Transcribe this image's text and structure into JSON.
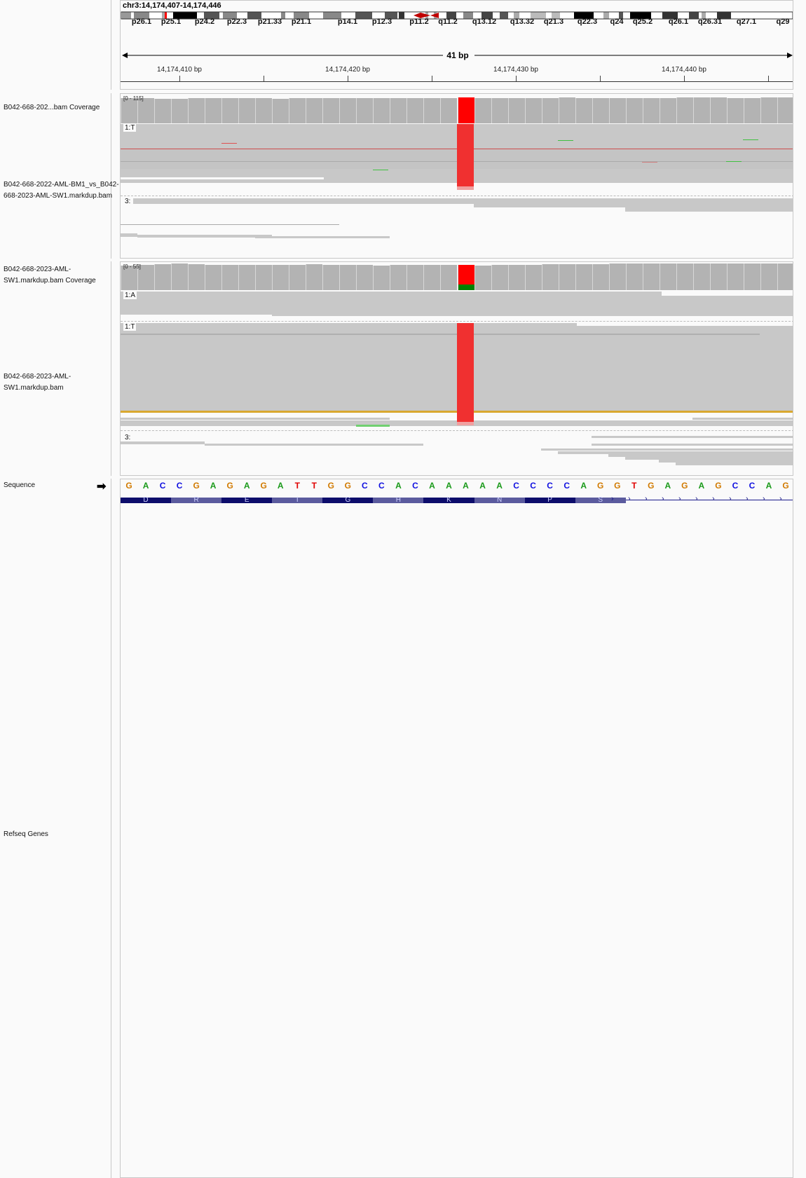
{
  "header": {
    "locus": "chr3:14,174,407-14,174,446",
    "bands": [
      "p26.1",
      "p25.1",
      "p24.2",
      "p22.3",
      "p21.33",
      "p21.1",
      "p14.1",
      "p12.3",
      "p11.2",
      "q11.2",
      "q13.12",
      "q13.32",
      "q21.3",
      "q22.3",
      "q24",
      "q25.2",
      "q26.1",
      "q26.31",
      "q27.1",
      "q29"
    ],
    "span": "41 bp",
    "ticks": [
      "14,174,410 bp",
      "14,174,420 bp",
      "14,174,430 bp",
      "14,174,440 bp"
    ]
  },
  "tracks": {
    "cov1_label": "B042-668-202...bam Coverage",
    "cov1_range": "[0 - 115]",
    "bam1_label": "B042-668-2022-AML-BM1_vs_B042-668-2023-AML-SW1.markdup.bam",
    "bam1_groups": [
      "1:T",
      "3:"
    ],
    "cov2_label": "B042-668-2023-AML-SW1.markdup.bam Coverage",
    "cov2_range": "[0 - 55]",
    "bam2_label": "B042-668-2023-AML-SW1.markdup.bam",
    "bam2_groups": [
      "1:A",
      "1:T",
      "3:"
    ],
    "seq_label": "Sequence",
    "genes_label": "Refseq Genes"
  },
  "sequence": {
    "bases": [
      "G",
      "A",
      "C",
      "C",
      "G",
      "A",
      "G",
      "A",
      "G",
      "A",
      "T",
      "T",
      "G",
      "G",
      "C",
      "C",
      "A",
      "C",
      "A",
      "A",
      "A",
      "A",
      "A",
      "C",
      "C",
      "C",
      "C",
      "A",
      "G",
      "G",
      "T",
      "G",
      "A",
      "G",
      "A",
      "G",
      "C",
      "C",
      "A",
      "G"
    ],
    "amino_acids": [
      "D",
      "R",
      "E",
      "I",
      "G",
      "H",
      "K",
      "N",
      "P",
      "S"
    ]
  },
  "colors": {
    "A": "#1a9a1a",
    "C": "#1010e0",
    "G": "#d17a00",
    "T": "#e00000",
    "mismatch": "#ff0000",
    "coverage": "#b3b3b3",
    "exon_dark": "#0d0d6b",
    "exon_light": "#5b5b9e"
  }
}
